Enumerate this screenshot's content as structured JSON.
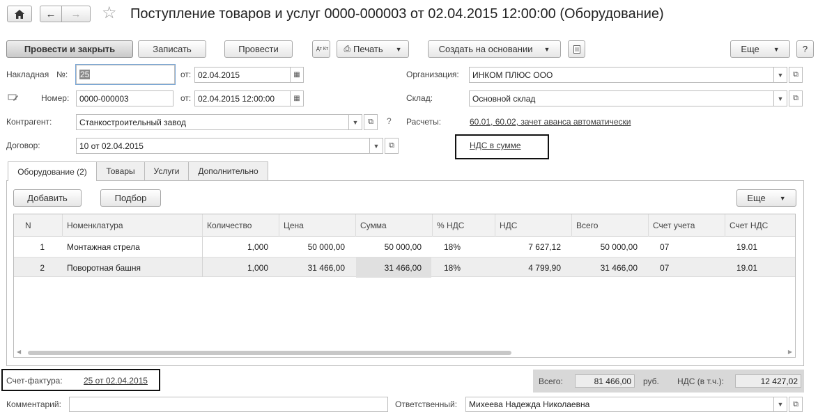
{
  "header": {
    "title": "Поступление товаров и услуг 0000-000003 от 02.04.2015 12:00:00 (Оборудование)"
  },
  "toolbar": {
    "post_close": "Провести и закрыть",
    "save": "Записать",
    "post": "Провести",
    "print": "Печать",
    "create_based": "Создать на основании",
    "more": "Еще",
    "help": "?",
    "dtkt": "Дт Кт"
  },
  "form": {
    "invoice_label": "Накладная",
    "no_label": "№:",
    "invoice_no": "25",
    "from_label": "от:",
    "invoice_date": "02.04.2015",
    "number_label": "Номер:",
    "number": "0000-000003",
    "number_date": "02.04.2015 12:00:00",
    "counterparty_label": "Контрагент:",
    "counterparty": "Станкостроительный завод",
    "question": "?",
    "contract_label": "Договор:",
    "contract": "10 от 02.04.2015",
    "org_label": "Организация:",
    "org": "ИНКОМ ПЛЮС ООО",
    "warehouse_label": "Склад:",
    "warehouse": "Основной склад",
    "settlements_label": "Расчеты:",
    "settlements": "60.01, 60.02, зачет аванса автоматически",
    "vat_mode": "НДС в сумме"
  },
  "tabs": [
    {
      "label": "Оборудование (2)"
    },
    {
      "label": "Товары"
    },
    {
      "label": "Услуги"
    },
    {
      "label": "Дополнительно"
    }
  ],
  "table_toolbar": {
    "add": "Добавить",
    "select": "Подбор",
    "more": "Еще"
  },
  "table": {
    "columns": [
      "N",
      "Номенклатура",
      "Количество",
      "Цена",
      "Сумма",
      "% НДС",
      "НДС",
      "Всего",
      "Счет учета",
      "Счет НДС"
    ],
    "rows": [
      {
        "n": "1",
        "item": "Монтажная стрела",
        "qty": "1,000",
        "price": "50 000,00",
        "sum": "50 000,00",
        "vat_rate": "18%",
        "vat": "7 627,12",
        "total": "50 000,00",
        "account": "07",
        "vat_account": "19.01"
      },
      {
        "n": "2",
        "item": "Поворотная башня",
        "qty": "1,000",
        "price": "31 466,00",
        "sum": "31 466,00",
        "vat_rate": "18%",
        "vat": "4 799,90",
        "total": "31 466,00",
        "account": "07",
        "vat_account": "19.01"
      }
    ]
  },
  "footer": {
    "invoice_label": "Счет-фактура:",
    "invoice_link": "25 от 02.04.2015",
    "total_label": "Всего:",
    "total": "81 466,00",
    "currency": "руб.",
    "vat_label": "НДС (в т.ч.):",
    "vat_total": "12 427,02",
    "comment_label": "Комментарий:",
    "responsible_label": "Ответственный:",
    "responsible": "Михеева Надежда Николаевна"
  },
  "colors": {
    "selection_row": "#eeeeee",
    "selected_cell": "#e3e3e3",
    "outline_box": "#111111"
  }
}
